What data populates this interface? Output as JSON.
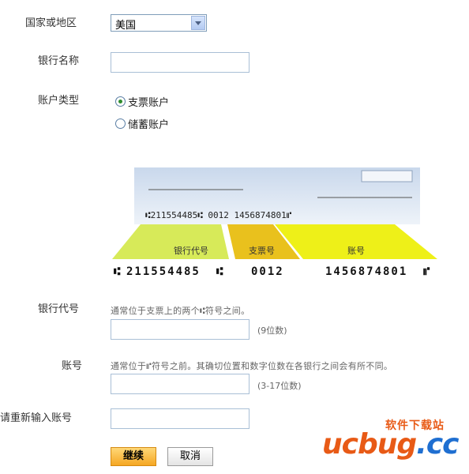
{
  "form": {
    "country_label": "国家或地区",
    "country_value": "美国",
    "bank_name_label": "银行名称",
    "account_type_label": "账户类型",
    "account_types": [
      "支票账户",
      "储蓄账户"
    ],
    "account_type_selected": "支票账户",
    "routing_label": "银行代号",
    "routing_hint": "通常位于支票上的两个⑆符号之间。",
    "routing_unit": "(9位数)",
    "account_label": "账号",
    "account_hint": "通常位于⑈符号之前。其确切位置和数字位数在各银行之间会有所不同。",
    "account_unit": "(3-17位数)",
    "reenter_label": "请重新输入账号"
  },
  "check": {
    "micr_line": "⑆211554485⑆  0012  1456874801⑈",
    "routing_number": "211554485",
    "check_number": "0012",
    "account_number": "1456874801",
    "routing_caption": "银行代号",
    "check_caption": "支票号",
    "account_caption": "账号"
  },
  "buttons": {
    "continue_label": "继续",
    "cancel_label": "取消"
  },
  "watermark": {
    "top_text": "软件下载站",
    "main_text": "ucbug.cc"
  },
  "colors": {
    "routing_band": "#d7ea59",
    "check_band": "#e9c11d",
    "account_band": "#eef018",
    "check_bg": "#dbe6f3",
    "primary_button": "#f5a623"
  }
}
